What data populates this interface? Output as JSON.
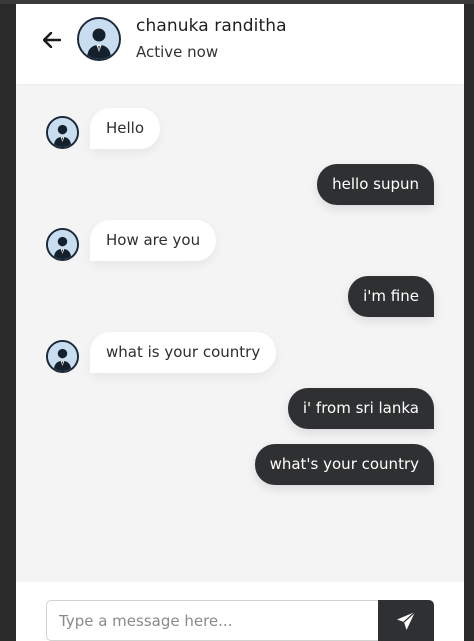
{
  "header": {
    "name": "chanuka randitha",
    "status": "Active now",
    "back_icon": "arrow-left-icon",
    "avatar_icon": "user-avatar"
  },
  "messages": [
    {
      "direction": "incoming",
      "text": "Hello"
    },
    {
      "direction": "outgoing",
      "text": "hello supun"
    },
    {
      "direction": "incoming",
      "text": "How are you"
    },
    {
      "direction": "outgoing",
      "text": "i'm fine"
    },
    {
      "direction": "incoming",
      "text": "what is your country"
    },
    {
      "direction": "outgoing",
      "text": "i' from sri lanka"
    },
    {
      "direction": "outgoing",
      "text": "what's your country"
    }
  ],
  "composer": {
    "placeholder": "Type a message here...",
    "value": "",
    "send_icon": "paper-plane-icon"
  },
  "colors": {
    "chat_background": "#f4f4f5",
    "incoming_bubble": "#ffffff",
    "outgoing_bubble": "#2f3031",
    "outgoing_text": "#ffffff"
  }
}
